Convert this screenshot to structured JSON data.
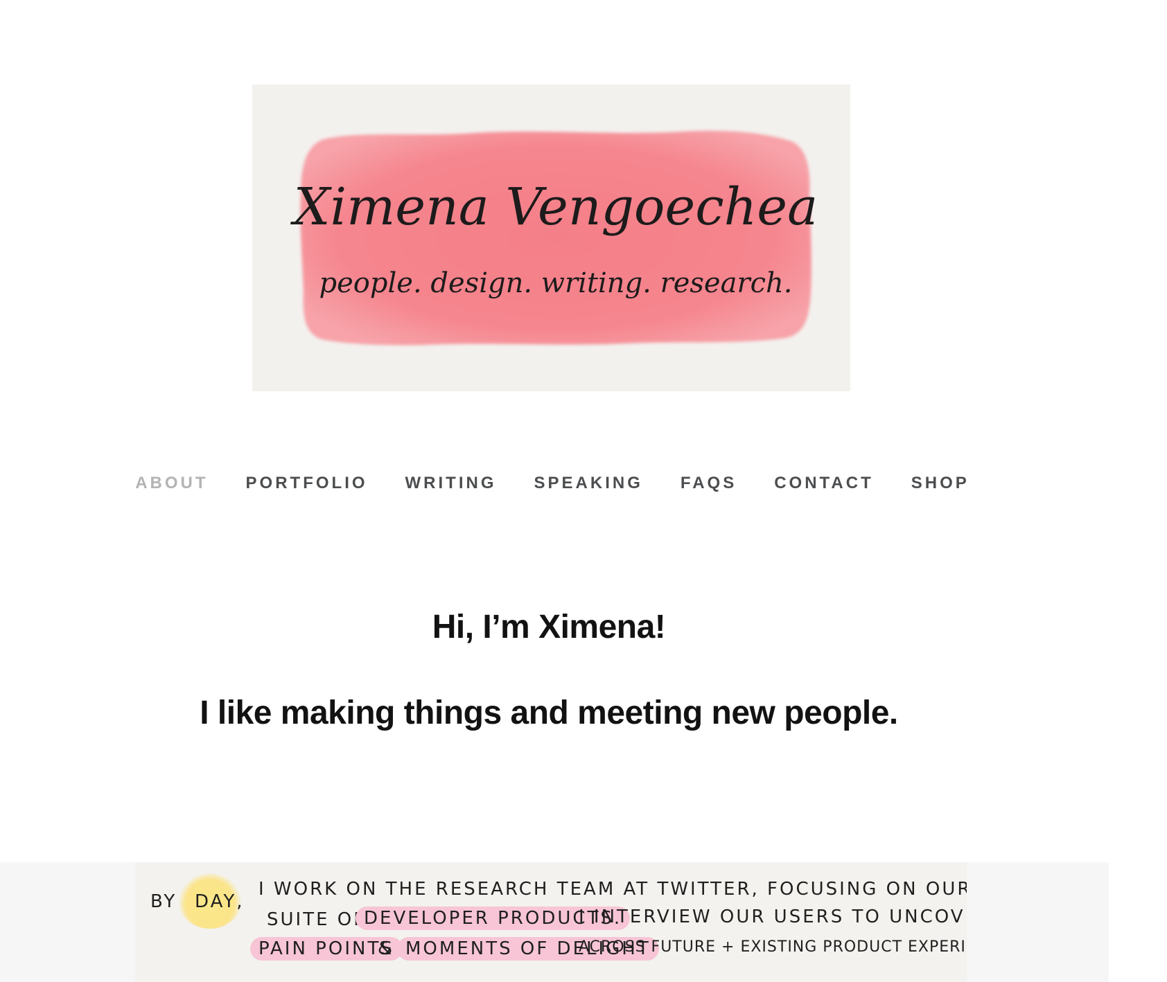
{
  "logo": {
    "name": "Ximena Vengoechea",
    "tagline": "people. design. writing. research.",
    "banner_color": "#f58a92"
  },
  "nav": {
    "items": [
      {
        "label": "ABOUT",
        "active": true
      },
      {
        "label": "PORTFOLIO",
        "active": false
      },
      {
        "label": "WRITING",
        "active": false
      },
      {
        "label": "SPEAKING",
        "active": false
      },
      {
        "label": "FAQS",
        "active": false
      },
      {
        "label": "CONTACT",
        "active": false
      },
      {
        "label": "SHOP",
        "active": false
      }
    ]
  },
  "intro": {
    "greeting": "Hi, I’m Ximena!",
    "line": "I like making things and meeting new people."
  },
  "notes": {
    "by": "BY",
    "day": "DAY,",
    "line1": "I WORK ON THE RESEARCH TEAM AT TWITTER, FOCUSING ON OUR",
    "line2_a": "SUITE OF",
    "line2_hl": "DEVELOPER PRODUCTS.",
    "line2_b": "I INTERVIEW OUR USERS TO UNCOVER",
    "line3_hl1": "PAIN POINTS",
    "line3_amp": "&",
    "line3_hl2": "MOMENTS OF DELIGHT",
    "line3_b": "ACROSS FUTURE + EXISTING PRODUCT EXPERIENCES."
  },
  "colors": {
    "nav_text": "#4b4d4f",
    "nav_active": "#b3b3b3",
    "highlight_pink": "#f7c5d6",
    "sun_yellow": "#fbe48a"
  }
}
